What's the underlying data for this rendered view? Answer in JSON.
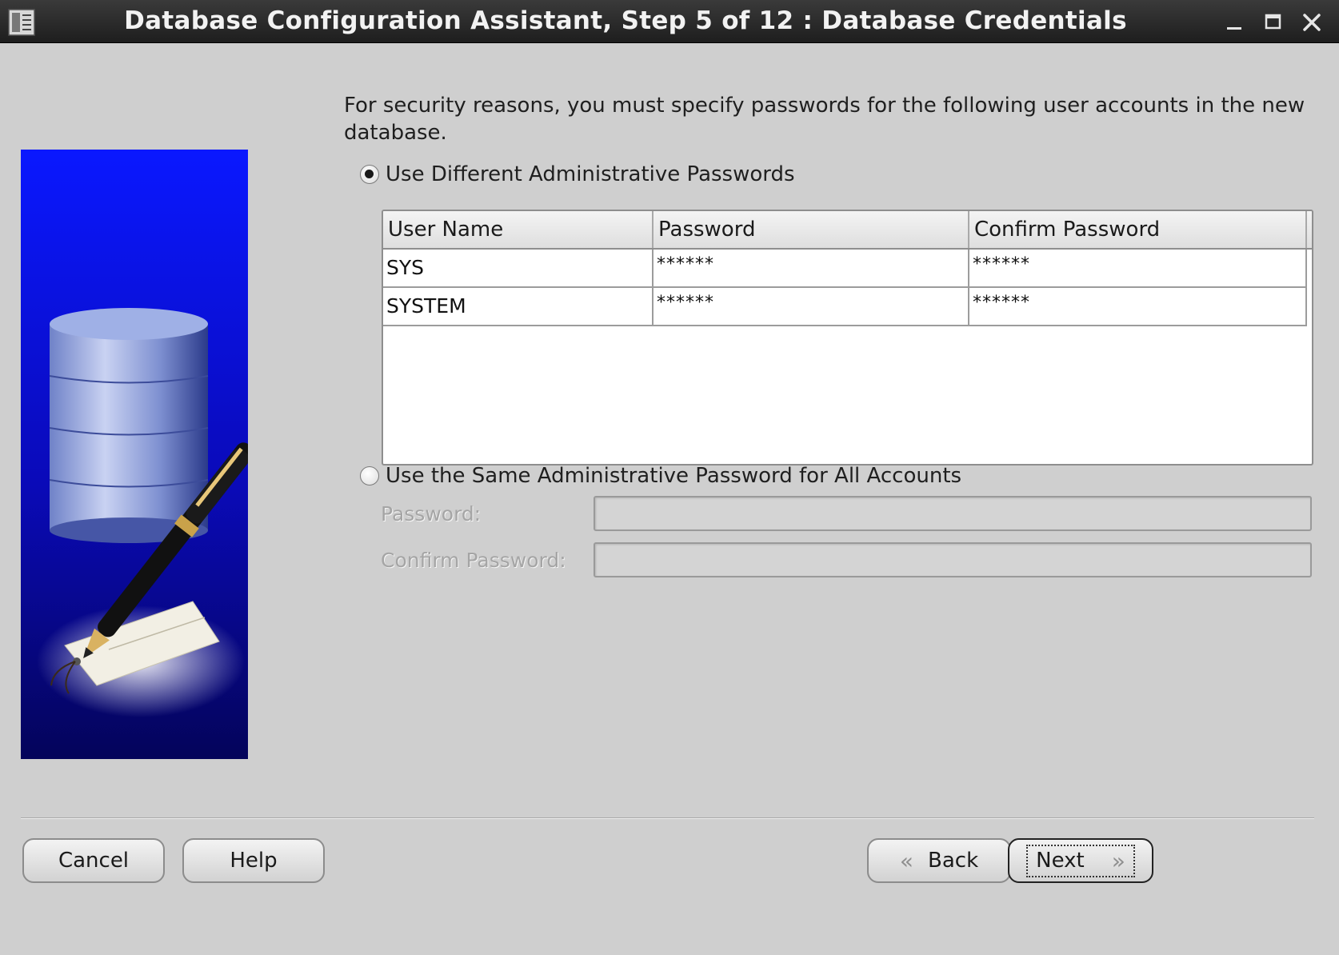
{
  "window": {
    "title": "Database Configuration Assistant, Step 5 of 12 : Database Credentials",
    "controls": [
      "minimize",
      "maximize",
      "close"
    ]
  },
  "intro_text": "For security reasons, you must specify passwords for the following user accounts in the new database.",
  "option_different": {
    "label": "Use Different Administrative Passwords",
    "selected": true
  },
  "table": {
    "headers": [
      "User Name",
      "Password",
      "Confirm Password"
    ],
    "rows": [
      {
        "user": "SYS",
        "password": "******",
        "confirm": "******"
      },
      {
        "user": "SYSTEM",
        "password": "******",
        "confirm": "******"
      }
    ]
  },
  "option_same": {
    "label": "Use the Same Administrative Password for All Accounts",
    "selected": false,
    "password_label": "Password:",
    "confirm_label": "Confirm Password:",
    "password_value": "",
    "confirm_value": ""
  },
  "buttons": {
    "cancel": "Cancel",
    "help": "Help",
    "back": "Back",
    "next": "Next"
  },
  "icons": {
    "app": "database-app-icon",
    "back": "chevron-left-icon",
    "next": "chevron-right-icon"
  },
  "colors": {
    "titlebar": "#2a2a2a",
    "background": "#cfcfcf",
    "panel_blue": "#1a1acc"
  }
}
